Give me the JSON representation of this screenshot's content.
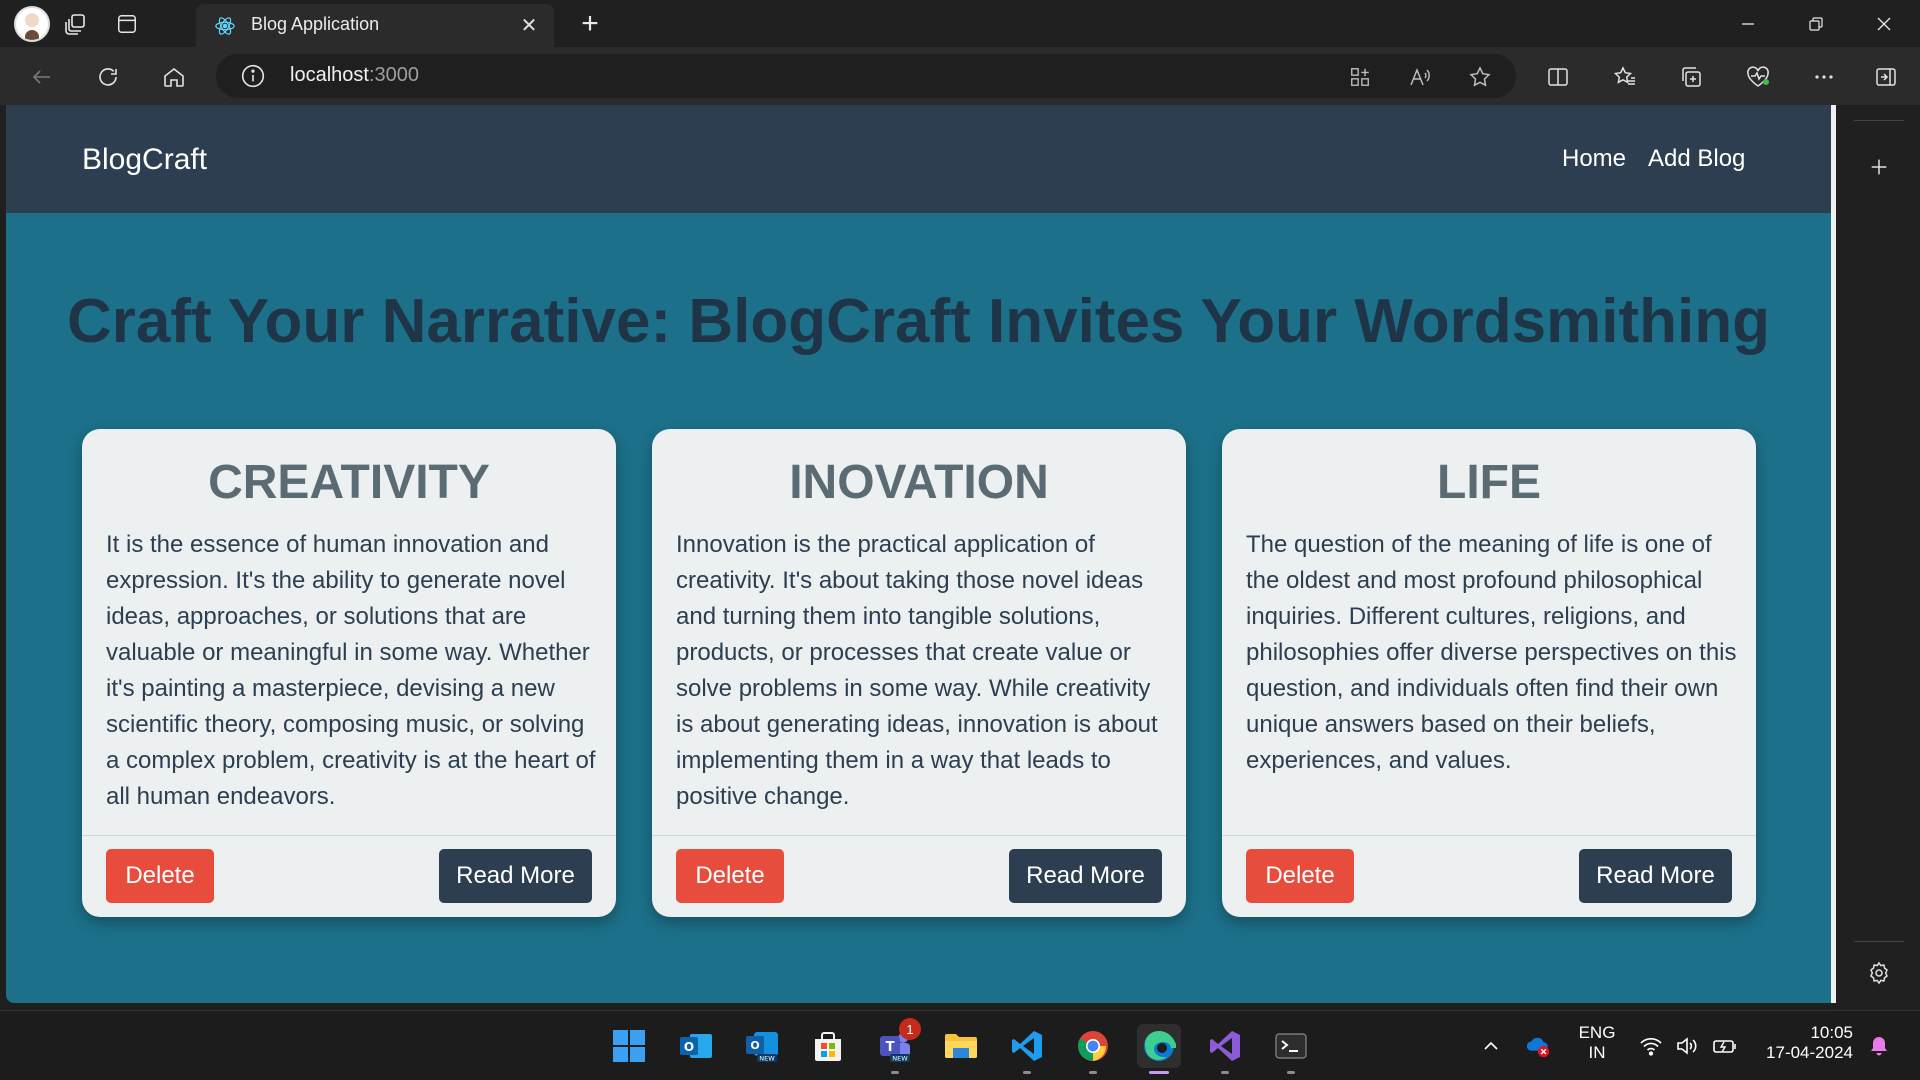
{
  "browser": {
    "tab_title": "Blog Application",
    "address_host": "localhost",
    "address_port": ":3000"
  },
  "site": {
    "brand": "BlogCraft",
    "nav": [
      "Home",
      "Add Blog"
    ],
    "hero": "Craft Your Narrative: BlogCraft Invites Your Wordsmithing"
  },
  "cards": [
    {
      "title": "CREATIVITY",
      "body": "It is the essence of human innovation and expression. It's the ability to generate novel ideas, approaches, or solutions that are valuable or meaningful in some way. Whether it's painting a masterpiece, devising a new scientific theory, composing music, or solving a complex problem, creativity is at the heart of all human endeavors.",
      "delete_label": "Delete",
      "read_label": "Read More"
    },
    {
      "title": "INOVATION",
      "body": "Innovation is the practical application of creativity. It's about taking those novel ideas and turning them into tangible solutions, products, or processes that create value or solve problems in some way. While creativity is about generating ideas, innovation is about implementing them in a way that leads to positive change.",
      "delete_label": "Delete",
      "read_label": "Read More"
    },
    {
      "title": "LIFE",
      "body": "The question of the meaning of life is one of the oldest and most profound philosophical inquiries. Different cultures, religions, and philosophies offer diverse perspectives on this question, and individuals often find their own unique answers based on their beliefs, experiences, and values.",
      "delete_label": "Delete",
      "read_label": "Read More"
    }
  ],
  "taskbar": {
    "teams_badge": "1",
    "lang_line1": "ENG",
    "lang_line2": "IN",
    "time": "10:05",
    "date": "17-04-2024"
  },
  "colors": {
    "page_bg": "#1c7089",
    "navbar_bg": "#2d3e50",
    "card_bg": "#ecf0f1",
    "delete": "#e74c3c",
    "read_more": "#2d3e50"
  }
}
